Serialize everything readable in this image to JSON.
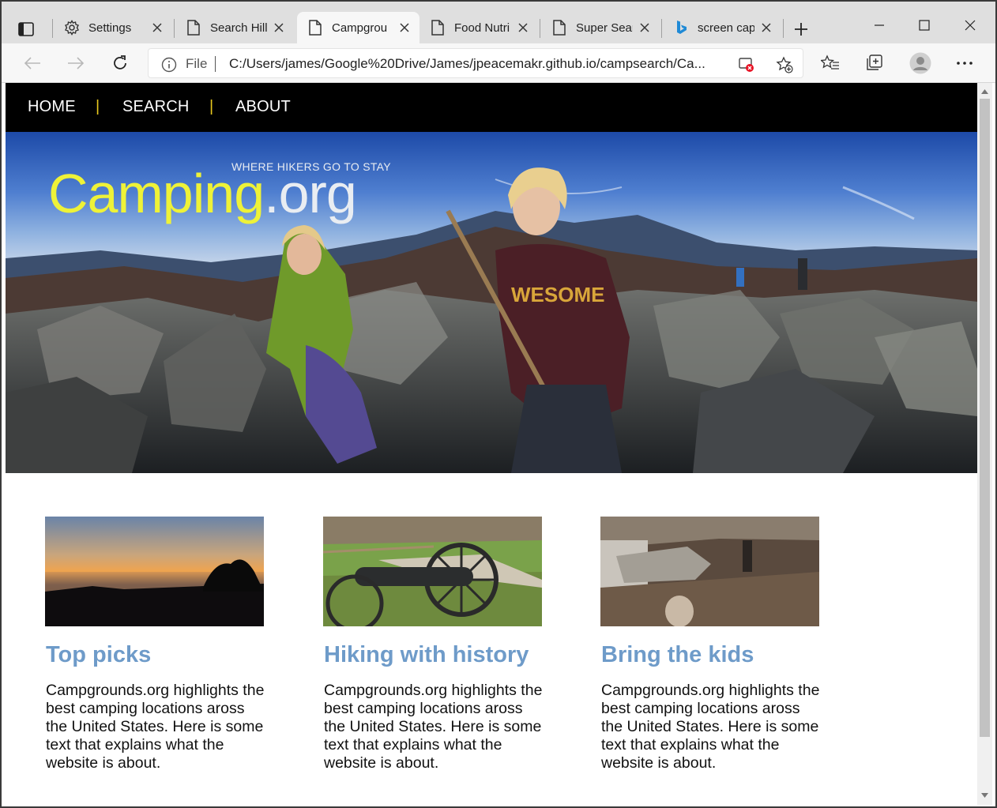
{
  "browser": {
    "tabs": [
      {
        "label": "Settings",
        "icon": "gear-icon"
      },
      {
        "label": "Search Hill",
        "icon": "page-icon"
      },
      {
        "label": "Campgrou",
        "icon": "page-icon",
        "active": true
      },
      {
        "label": "Food Nutri",
        "icon": "page-icon"
      },
      {
        "label": "Super Sear",
        "icon": "page-icon"
      },
      {
        "label": "screen cap",
        "icon": "bing-icon"
      }
    ],
    "address": {
      "scheme_label": "File",
      "url": "C:/Users/james/Google%20Drive/James/jpeacemakr.github.io/campsearch/Ca..."
    }
  },
  "site": {
    "nav": {
      "home": "HOME",
      "search": "SEARCH",
      "about": "ABOUT",
      "separator": "|"
    },
    "hero": {
      "logo_tagline": "WHERE HIKERS GO TO STAY",
      "logo_main": "Camping",
      "logo_suffix": ".org",
      "shirt_text": "WESOME"
    },
    "cards": [
      {
        "title": "Top picks",
        "text": "Campgrounds.org highlights the best camping locations aross the United States. Here is some text that explains what the website is about."
      },
      {
        "title": "Hiking with history",
        "text": "Campgrounds.org highlights the best camping locations aross the United States. Here is some text that explains what the website is about."
      },
      {
        "title": "Bring the kids",
        "text": "Campgrounds.org highlights the best camping locations aross the United States. Here is some text that explains what the website is about."
      }
    ]
  },
  "colors": {
    "nav_bg": "#000000",
    "nav_separator": "#e8c81e",
    "logo_yellow": "#eef238",
    "card_title": "#6e9bc9"
  }
}
